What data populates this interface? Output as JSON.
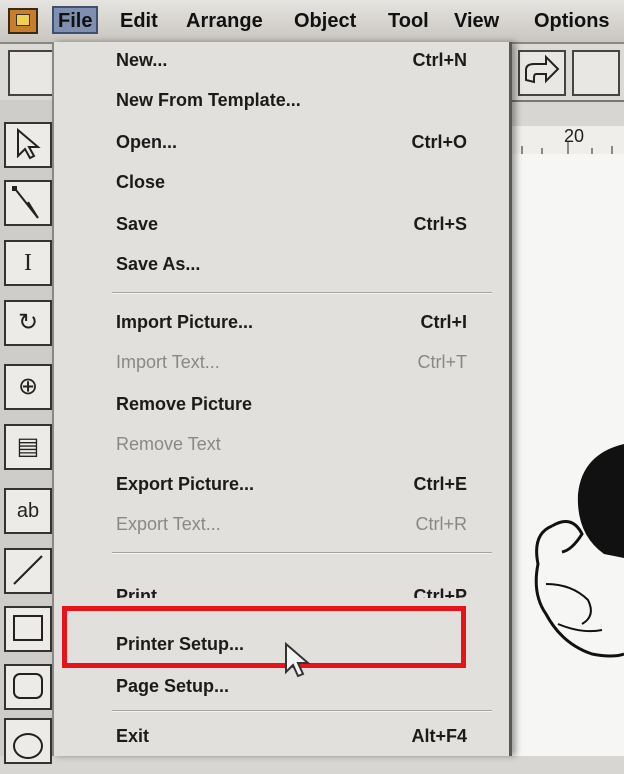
{
  "menubar": {
    "items": [
      "File",
      "Edit",
      "Arrange",
      "Object",
      "Tool",
      "View",
      "Options"
    ],
    "active": "File"
  },
  "ruler": {
    "label": "20"
  },
  "file_menu": {
    "items": [
      {
        "label": "New...",
        "shortcut": "Ctrl+N",
        "enabled": true
      },
      {
        "label": "New From Template...",
        "shortcut": "",
        "enabled": true
      },
      {
        "label": "Open...",
        "shortcut": "Ctrl+O",
        "enabled": true
      },
      {
        "label": "Close",
        "shortcut": "",
        "enabled": true
      },
      {
        "label": "Save",
        "shortcut": "Ctrl+S",
        "enabled": true
      },
      {
        "label": "Save As...",
        "shortcut": "",
        "enabled": true
      },
      {
        "label": "Import Picture...",
        "shortcut": "Ctrl+I",
        "enabled": true
      },
      {
        "label": "Import Text...",
        "shortcut": "Ctrl+T",
        "enabled": false
      },
      {
        "label": "Remove Picture",
        "shortcut": "",
        "enabled": true
      },
      {
        "label": "Remove Text",
        "shortcut": "",
        "enabled": false
      },
      {
        "label": "Export Picture...",
        "shortcut": "Ctrl+E",
        "enabled": true
      },
      {
        "label": "Export Text...",
        "shortcut": "Ctrl+R",
        "enabled": false
      },
      {
        "label": "Print",
        "shortcut": "Ctrl+P",
        "enabled": true
      },
      {
        "label": "Printer Setup...",
        "shortcut": "",
        "enabled": true
      },
      {
        "label": "Page Setup...",
        "shortcut": "",
        "enabled": true
      },
      {
        "label": "Exit",
        "shortcut": "Alt+F4",
        "enabled": true
      }
    ]
  },
  "toolbox": {
    "icons": [
      "page-icon",
      "pointer-icon",
      "reshape-icon",
      "text-tool-icon",
      "rotate-icon",
      "zoom-icon",
      "page-view-icon",
      "text-frame-icon",
      "line-tool-icon",
      "rectangle-tool-icon",
      "rounded-rect-tool-icon",
      "ellipse-tool-icon"
    ]
  },
  "colors": {
    "highlight": "#e4141a",
    "active_menu": "#7f8fb0"
  }
}
